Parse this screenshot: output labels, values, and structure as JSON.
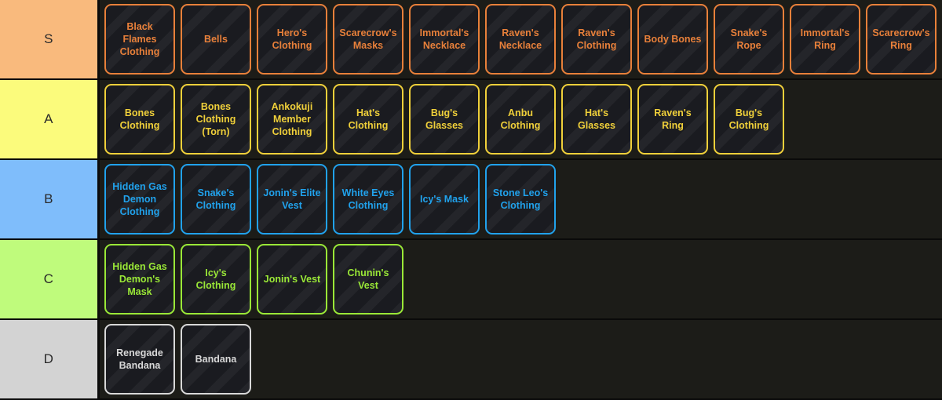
{
  "page": {
    "background_color": "#1c1c18",
    "card_background_color": "#1a1b20",
    "row_divider_color": "#0a0a0a",
    "label_text_color": "#2a2a2a"
  },
  "tiers": [
    {
      "label": "S",
      "label_color": "#f9ba7d",
      "accent_color": "#e8803a",
      "items": [
        "Black Flames Clothing",
        "Bells",
        "Hero's Clothing",
        "Scarecrow's Masks",
        "Immortal's Necklace",
        "Raven's Necklace",
        "Raven's Clothing",
        "Body Bones",
        "Snake's Rope",
        "Immortal's Ring",
        "Scarecrow's Ring"
      ]
    },
    {
      "label": "A",
      "label_color": "#fbfb7c",
      "accent_color": "#f0d03a",
      "items": [
        "Bones Clothing",
        "Bones Clothing (Torn)",
        "Ankokuji Member Clothing",
        "Hat's Clothing",
        "Bug's Glasses",
        "Anbu Clothing",
        "Hat's Glasses",
        "Raven's Ring",
        "Bug's Clothing"
      ]
    },
    {
      "label": "B",
      "label_color": "#7fbdfb",
      "accent_color": "#21a2ec",
      "items": [
        "Hidden Gas Demon Clothing",
        "Snake's Clothing",
        "Jonin's Elite Vest",
        "White Eyes Clothing",
        "Icy's Mask",
        "Stone Leo's Clothing"
      ]
    },
    {
      "label": "C",
      "label_color": "#bffb7c",
      "accent_color": "#9ae837",
      "items": [
        "Hidden Gas Demon's Mask",
        "Icy's Clothing",
        "Jonin's Vest",
        "Chunin's Vest"
      ]
    },
    {
      "label": "D",
      "label_color": "#d3d3d3",
      "accent_color": "#d8d8d8",
      "items": [
        "Renegade Bandana",
        "Bandana"
      ]
    }
  ]
}
